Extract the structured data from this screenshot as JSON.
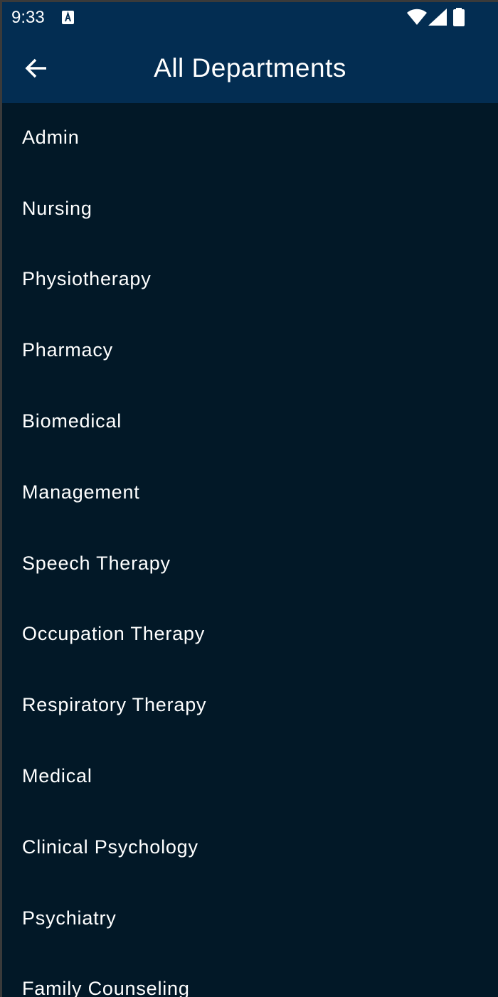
{
  "status_bar": {
    "time": "9:33",
    "icons": [
      "accessibility-a-icon",
      "wifi-icon",
      "cellular-signal-icon",
      "battery-icon"
    ]
  },
  "app_bar": {
    "back_icon": "arrow-left-icon",
    "title": "All Departments"
  },
  "colors": {
    "app_bar_bg": "#032d52",
    "list_bg": "#021827",
    "text": "#ffffff"
  },
  "departments": [
    {
      "label": "Admin"
    },
    {
      "label": "Nursing"
    },
    {
      "label": "Physiotherapy"
    },
    {
      "label": "Pharmacy"
    },
    {
      "label": "Biomedical"
    },
    {
      "label": "Management"
    },
    {
      "label": "Speech Therapy"
    },
    {
      "label": "Occupation Therapy"
    },
    {
      "label": "Respiratory Therapy"
    },
    {
      "label": "Medical"
    },
    {
      "label": "Clinical Psychology"
    },
    {
      "label": "Psychiatry"
    },
    {
      "label": "Family Counseling"
    }
  ]
}
